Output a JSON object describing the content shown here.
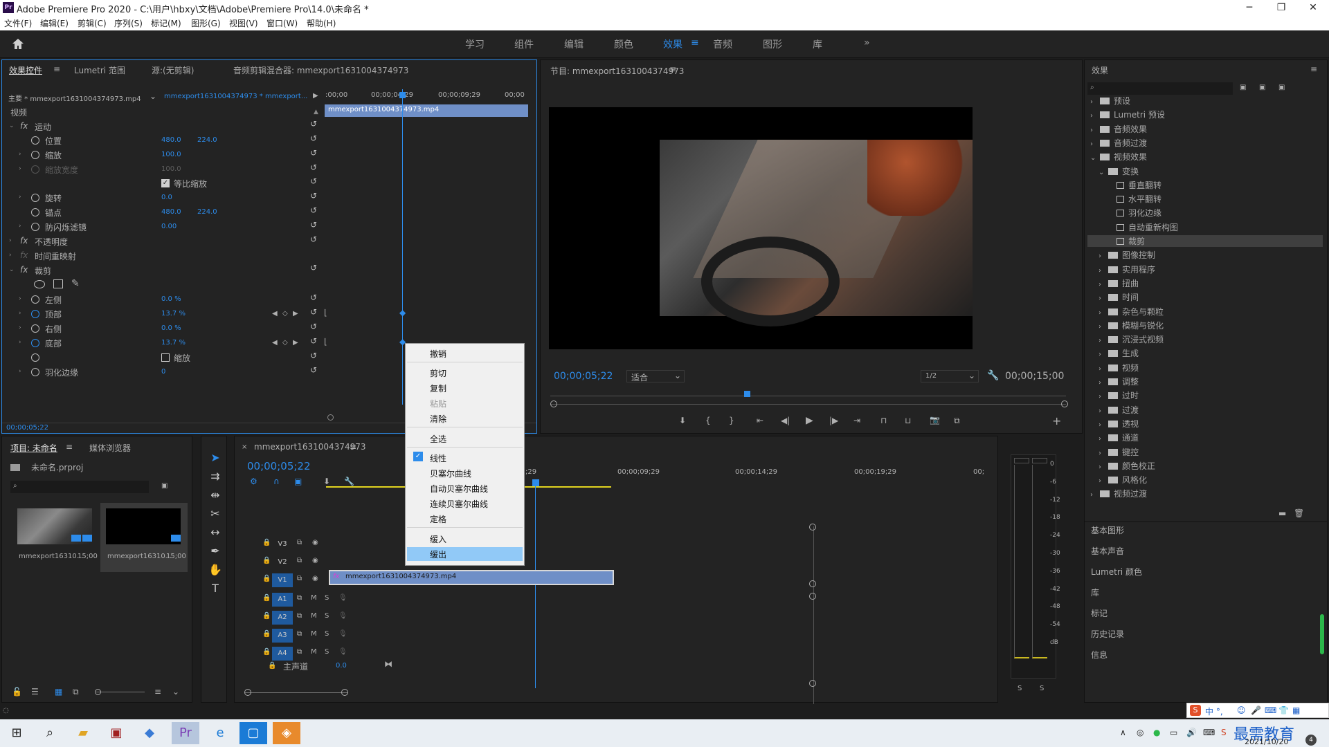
{
  "window": {
    "app_icon": "Pr",
    "title": "Adobe Premiere Pro 2020 - C:\\用户\\hbxy\\文档\\Adobe\\Premiere Pro\\14.0\\未命名 *",
    "minimize": "─",
    "maximize": "❐",
    "close": "✕"
  },
  "menu": [
    "文件(F)",
    "编辑(E)",
    "剪辑(C)",
    "序列(S)",
    "标记(M)",
    "图形(G)",
    "视图(V)",
    "窗口(W)",
    "帮助(H)"
  ],
  "workspaces": {
    "items": [
      "学习",
      "组件",
      "编辑",
      "颜色",
      "效果",
      "音频",
      "图形",
      "库"
    ],
    "active": "效果",
    "more": "»"
  },
  "effect_controls": {
    "tabs": [
      "效果控件",
      "Lumetri 范围",
      "源:(无剪辑)",
      "音频剪辑混合器: mmexport1631004374973"
    ],
    "master_label": "主要 * mmexport1631004374973.mp4",
    "sequence_label": "mmexport1631004374973 * mmexport...",
    "ruler": [
      ":00;00",
      "00;00;04;29",
      "00;00;09;29",
      "00;00"
    ],
    "clip_bar": "mmexport1631004374973.mp4",
    "section_video": "视频",
    "motion": "运动",
    "position": {
      "label": "位置",
      "x": "480.0",
      "y": "224.0"
    },
    "scale": {
      "label": "缩放",
      "value": "100.0"
    },
    "scale_width": {
      "label": "缩放宽度",
      "value": "100.0"
    },
    "uniform_scale": "等比缩放",
    "rotation": {
      "label": "旋转",
      "value": "0.0"
    },
    "anchor": {
      "label": "锚点",
      "x": "480.0",
      "y": "224.0"
    },
    "flicker": {
      "label": "防闪烁滤镜",
      "value": "0.00"
    },
    "opacity": "不透明度",
    "time_remap": "时间重映射",
    "crop": "裁剪",
    "left": {
      "label": "左侧",
      "value": "0.0 %"
    },
    "top": {
      "label": "顶部",
      "value": "13.7 %"
    },
    "right": {
      "label": "右侧",
      "value": "0.0 %"
    },
    "bottom": {
      "label": "底部",
      "value": "13.7 %"
    },
    "zoom": "缩放",
    "feather": {
      "label": "羽化边缘",
      "value": "0"
    },
    "footer_time": "00;00;05;22"
  },
  "program": {
    "title": "节目: mmexport1631004374973",
    "timecode": "00;00;05;22",
    "fit": "适合",
    "quality": "1/2",
    "duration": "00;00;15;00"
  },
  "context_menu": {
    "items": [
      "撤销",
      "剪切",
      "复制",
      "粘贴",
      "清除",
      "全选",
      "线性",
      "贝塞尔曲线",
      "自动贝塞尔曲线",
      "连续贝塞尔曲线",
      "定格",
      "缓入",
      "缓出"
    ],
    "checked": "线性",
    "highlighted": "缓出",
    "disabled": "粘贴"
  },
  "project": {
    "tabs": [
      "项目: 未命名",
      "媒体浏览器"
    ],
    "file": "未命名.prproj",
    "clips": [
      {
        "name": "mmexport16310...",
        "duration": "15;00"
      },
      {
        "name": "mmexport16310...",
        "duration": "15;00"
      }
    ]
  },
  "timeline": {
    "tab": "mmexport1631004374973",
    "timecode": "00;00;05;22",
    "ruler": [
      ";29",
      "00;00;09;29",
      "00;00;14;29",
      "00;00;19;29",
      "00;"
    ],
    "video_tracks": [
      "V3",
      "V2",
      "V1"
    ],
    "audio_tracks": [
      "A1",
      "A2",
      "A3",
      "A4"
    ],
    "master": "主声道",
    "master_value": "0.0",
    "clip": "mmexport1631004374973.mp4",
    "m": "M",
    "s": "S"
  },
  "meter": {
    "scale": [
      "0",
      "-6",
      "-12",
      "-18",
      "-24",
      "-30",
      "-36",
      "-42",
      "-48",
      "-54",
      "dB"
    ],
    "solo": [
      "S",
      "S"
    ]
  },
  "effects_panel": {
    "title": "效果",
    "tree": [
      {
        "label": "预设",
        "level": 0,
        "type": "folder",
        "arrow": "›"
      },
      {
        "label": "Lumetri 预设",
        "level": 0,
        "type": "folder",
        "arrow": "›"
      },
      {
        "label": "音频效果",
        "level": 0,
        "type": "folder",
        "arrow": "›"
      },
      {
        "label": "音频过渡",
        "level": 0,
        "type": "folder",
        "arrow": "›"
      },
      {
        "label": "视频效果",
        "level": 0,
        "type": "folder",
        "arrow": "⌄"
      },
      {
        "label": "变换",
        "level": 1,
        "type": "folder",
        "arrow": "⌄"
      },
      {
        "label": "垂直翻转",
        "level": 2,
        "type": "fx",
        "arrow": ""
      },
      {
        "label": "水平翻转",
        "level": 2,
        "type": "fx",
        "arrow": ""
      },
      {
        "label": "羽化边缘",
        "level": 2,
        "type": "fx",
        "arrow": ""
      },
      {
        "label": "自动重新构图",
        "level": 2,
        "type": "fx",
        "arrow": ""
      },
      {
        "label": "裁剪",
        "level": 2,
        "type": "fx",
        "arrow": "",
        "selected": true
      },
      {
        "label": "图像控制",
        "level": 1,
        "type": "folder",
        "arrow": "›"
      },
      {
        "label": "实用程序",
        "level": 1,
        "type": "folder",
        "arrow": "›"
      },
      {
        "label": "扭曲",
        "level": 1,
        "type": "folder",
        "arrow": "›"
      },
      {
        "label": "时间",
        "level": 1,
        "type": "folder",
        "arrow": "›"
      },
      {
        "label": "杂色与颗粒",
        "level": 1,
        "type": "folder",
        "arrow": "›"
      },
      {
        "label": "模糊与锐化",
        "level": 1,
        "type": "folder",
        "arrow": "›"
      },
      {
        "label": "沉浸式视频",
        "level": 1,
        "type": "folder",
        "arrow": "›"
      },
      {
        "label": "生成",
        "level": 1,
        "type": "folder",
        "arrow": "›"
      },
      {
        "label": "视频",
        "level": 1,
        "type": "folder",
        "arrow": "›"
      },
      {
        "label": "调整",
        "level": 1,
        "type": "folder",
        "arrow": "›"
      },
      {
        "label": "过时",
        "level": 1,
        "type": "folder",
        "arrow": "›"
      },
      {
        "label": "过渡",
        "level": 1,
        "type": "folder",
        "arrow": "›"
      },
      {
        "label": "透视",
        "level": 1,
        "type": "folder",
        "arrow": "›"
      },
      {
        "label": "通道",
        "level": 1,
        "type": "folder",
        "arrow": "›"
      },
      {
        "label": "键控",
        "level": 1,
        "type": "folder",
        "arrow": "›"
      },
      {
        "label": "颜色校正",
        "level": 1,
        "type": "folder",
        "arrow": "›"
      },
      {
        "label": "风格化",
        "level": 1,
        "type": "folder",
        "arrow": "›"
      },
      {
        "label": "视频过渡",
        "level": 0,
        "type": "folder",
        "arrow": "›"
      }
    ],
    "sections": [
      "基本图形",
      "基本声音",
      "Lumetri 颜色",
      "库",
      "标记",
      "历史记录",
      "信息"
    ]
  },
  "tray": {
    "ime": "中 °,",
    "watermark": "最需教育",
    "date": "2021/10/20",
    "badge": "4"
  },
  "colors": {
    "accent": "#2d8ceb",
    "clip": "#6f8fc7",
    "highlight": "#91c9f7",
    "panel": "#232323"
  }
}
